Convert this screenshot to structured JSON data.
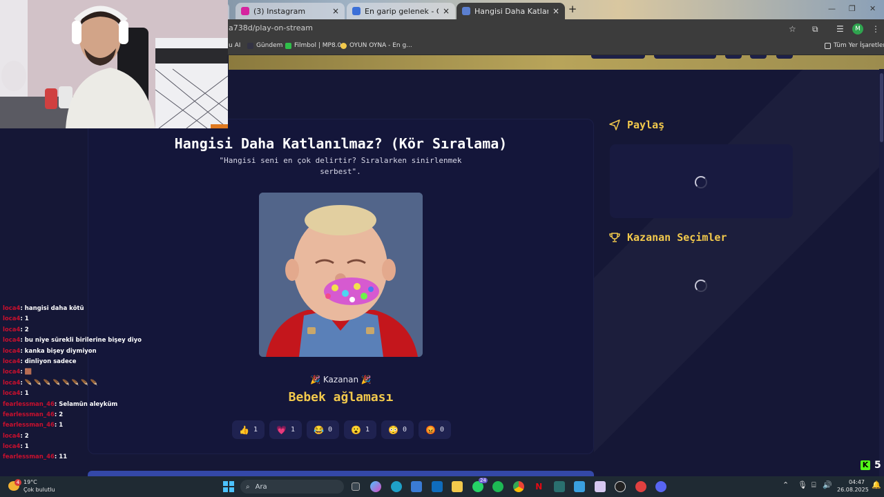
{
  "browser": {
    "tabs": [
      {
        "title": "(3) Instagram",
        "color": "#d6249f"
      },
      {
        "title": "En garip gelenek - Quizei",
        "color": "#3b6fd8"
      },
      {
        "title": "Hangisi Daha Katlanılmaz? (Kör",
        "color": "#5b7fd0"
      }
    ],
    "url": "a738d/play-on-stream",
    "profile_letter": "M",
    "bookmarks": [
      "u AI",
      "Gündem",
      "Filmbol | MP8.0",
      "OYUN OYNA - En g...",
      "Tüm Yer İşaretleri"
    ]
  },
  "game": {
    "title": "Hangisi Daha Katlanılmaz? (Kör Sıralama)",
    "subtitle": "\"Hangisi seni en çok delirtir? Sıralarken sinirlenmek serbest\".",
    "winner_label": "🎉 Kazanan 🎉",
    "winner_name": "Bebek ağlaması",
    "reactions": [
      {
        "emoji": "👍",
        "count": "1"
      },
      {
        "emoji": "💗",
        "count": "1"
      },
      {
        "emoji": "😂",
        "count": "0"
      },
      {
        "emoji": "😮",
        "count": "1"
      },
      {
        "emoji": "😳",
        "count": "0"
      },
      {
        "emoji": "😡",
        "count": "0"
      }
    ]
  },
  "sidebar": {
    "share_title": "Paylaş",
    "winners_title": "Kazanan Seçimler"
  },
  "stream": {
    "kick_count": "5",
    "chat": [
      {
        "user": "loca4",
        "text": ": hangisi daha kötü"
      },
      {
        "user": "loca4",
        "text": ": 1"
      },
      {
        "user": "loca4",
        "text": ": 2"
      },
      {
        "user": "loca4",
        "text": ": bu niye sürekli birilerine bişey diyo"
      },
      {
        "user": "loca4",
        "text": ": kanka bişey diymiyon"
      },
      {
        "user": "loca4",
        "text": ": dinliyon sadece"
      },
      {
        "user": "loca4",
        "text": ": 🟫"
      },
      {
        "user": "loca4",
        "text": ": 🪶 🪶 🪶 🪶 🪶 🪶 🪶 🪶"
      },
      {
        "user": "loca4",
        "text": ": 1"
      },
      {
        "user": "fearlessman_46",
        "text": ": Selamün aleyküm"
      },
      {
        "user": "fearlessman_46",
        "text": ": 2"
      },
      {
        "user": "fearlessman_46",
        "text": ": 1"
      },
      {
        "user": "loca4",
        "text": ": 2"
      },
      {
        "user": "loca4",
        "text": ": 1"
      },
      {
        "user": "fearlessman_46",
        "text": ": 11"
      }
    ]
  },
  "taskbar": {
    "weather_temp": "19°C",
    "weather_desc": "Çok bulutlu",
    "search_placeholder": "Ara",
    "time": "04:47",
    "date": "26.08.2025",
    "notification_count": "4",
    "whatsapp_badge": "24"
  }
}
